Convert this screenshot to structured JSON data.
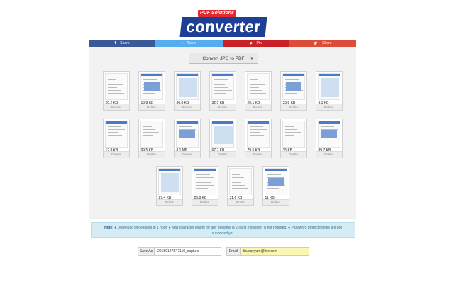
{
  "logo": {
    "tag": "PDF Solutions",
    "word": "converter"
  },
  "share": [
    {
      "icon": "f",
      "label": "Share"
    },
    {
      "icon": "t",
      "label": "Tweet"
    },
    {
      "icon": "p",
      "label": "Pin"
    },
    {
      "icon": "g+",
      "label": "Share"
    }
  ],
  "convert_select": {
    "value": "Convert JPG to PDF"
  },
  "files": [
    {
      "size": "20.2 KB",
      "delete": "Delete"
    },
    {
      "size": "18.8 KB",
      "delete": "Delete"
    },
    {
      "size": "36.8 KB",
      "delete": "Delete"
    },
    {
      "size": "32.5 KB",
      "delete": "Delete"
    },
    {
      "size": "20.1 KB",
      "delete": "Delete"
    },
    {
      "size": "33.8 KB",
      "delete": "Delete"
    },
    {
      "size": "6.1 KB",
      "delete": "Delete"
    },
    {
      "size": "12.8 KB",
      "delete": "Delete"
    },
    {
      "size": "99.5 KB",
      "delete": "Delete"
    },
    {
      "size": "8.1 MB",
      "delete": "Delete"
    },
    {
      "size": "67.7 KB",
      "delete": "Delete"
    },
    {
      "size": "79.5 KB",
      "delete": "Delete"
    },
    {
      "size": "35 KB",
      "delete": "Delete"
    },
    {
      "size": "89.7 KB",
      "delete": "Delete"
    },
    {
      "size": "27.4 KB",
      "delete": "Delete"
    },
    {
      "size": "26.8 KB",
      "delete": "Delete"
    },
    {
      "size": "31.6 KB",
      "delete": "Delete"
    },
    {
      "size": "11 KB",
      "delete": "Delete"
    }
  ],
  "note": {
    "label": "Note:",
    "text": "● Download link expires in 1 hour. ● Max character lenght for any filename is 20 and extension is not required. ● Password protected files are not supported yet."
  },
  "save_as": {
    "label": "Save As",
    "value": "20180127ST1110_capture"
  },
  "email": {
    "label": "Email",
    "value": "thuqayyum@live.com"
  },
  "colors": {
    "facebook": "#3b5998",
    "twitter": "#55acee",
    "pinterest": "#cb2027",
    "gplus": "#dd4b39",
    "brand_blue": "#1d3f95",
    "brand_red": "#e4292d"
  }
}
